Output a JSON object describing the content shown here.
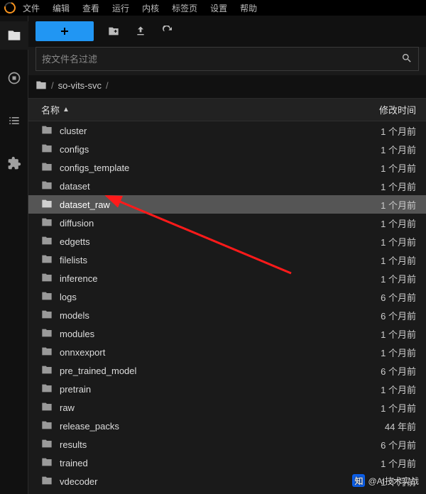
{
  "menu": {
    "items": [
      "文件",
      "编辑",
      "查看",
      "运行",
      "内核",
      "标签页",
      "设置",
      "帮助"
    ]
  },
  "toolbar": {
    "new": "+"
  },
  "search": {
    "placeholder": "按文件名过滤"
  },
  "breadcrumb": {
    "root": "/",
    "path": "so-vits-svc",
    "trail": "/"
  },
  "columns": {
    "name": "名称",
    "mtime": "修改时间"
  },
  "files": [
    {
      "name": "cluster",
      "mtime": "1 个月前",
      "selected": false
    },
    {
      "name": "configs",
      "mtime": "1 个月前",
      "selected": false
    },
    {
      "name": "configs_template",
      "mtime": "1 个月前",
      "selected": false
    },
    {
      "name": "dataset",
      "mtime": "1 个月前",
      "selected": false
    },
    {
      "name": "dataset_raw",
      "mtime": "1 个月前",
      "selected": true
    },
    {
      "name": "diffusion",
      "mtime": "1 个月前",
      "selected": false
    },
    {
      "name": "edgetts",
      "mtime": "1 个月前",
      "selected": false
    },
    {
      "name": "filelists",
      "mtime": "1 个月前",
      "selected": false
    },
    {
      "name": "inference",
      "mtime": "1 个月前",
      "selected": false
    },
    {
      "name": "logs",
      "mtime": "6 个月前",
      "selected": false
    },
    {
      "name": "models",
      "mtime": "6 个月前",
      "selected": false
    },
    {
      "name": "modules",
      "mtime": "1 个月前",
      "selected": false
    },
    {
      "name": "onnxexport",
      "mtime": "1 个月前",
      "selected": false
    },
    {
      "name": "pre_trained_model",
      "mtime": "6 个月前",
      "selected": false
    },
    {
      "name": "pretrain",
      "mtime": "1 个月前",
      "selected": false
    },
    {
      "name": "raw",
      "mtime": "1 个月前",
      "selected": false
    },
    {
      "name": "release_packs",
      "mtime": "44 年前",
      "selected": false
    },
    {
      "name": "results",
      "mtime": "6 个月前",
      "selected": false
    },
    {
      "name": "trained",
      "mtime": "1 个月前",
      "selected": false
    },
    {
      "name": "vdecoder",
      "mtime": "1 个月前",
      "selected": false
    }
  ],
  "watermark": "@AI技术实战"
}
